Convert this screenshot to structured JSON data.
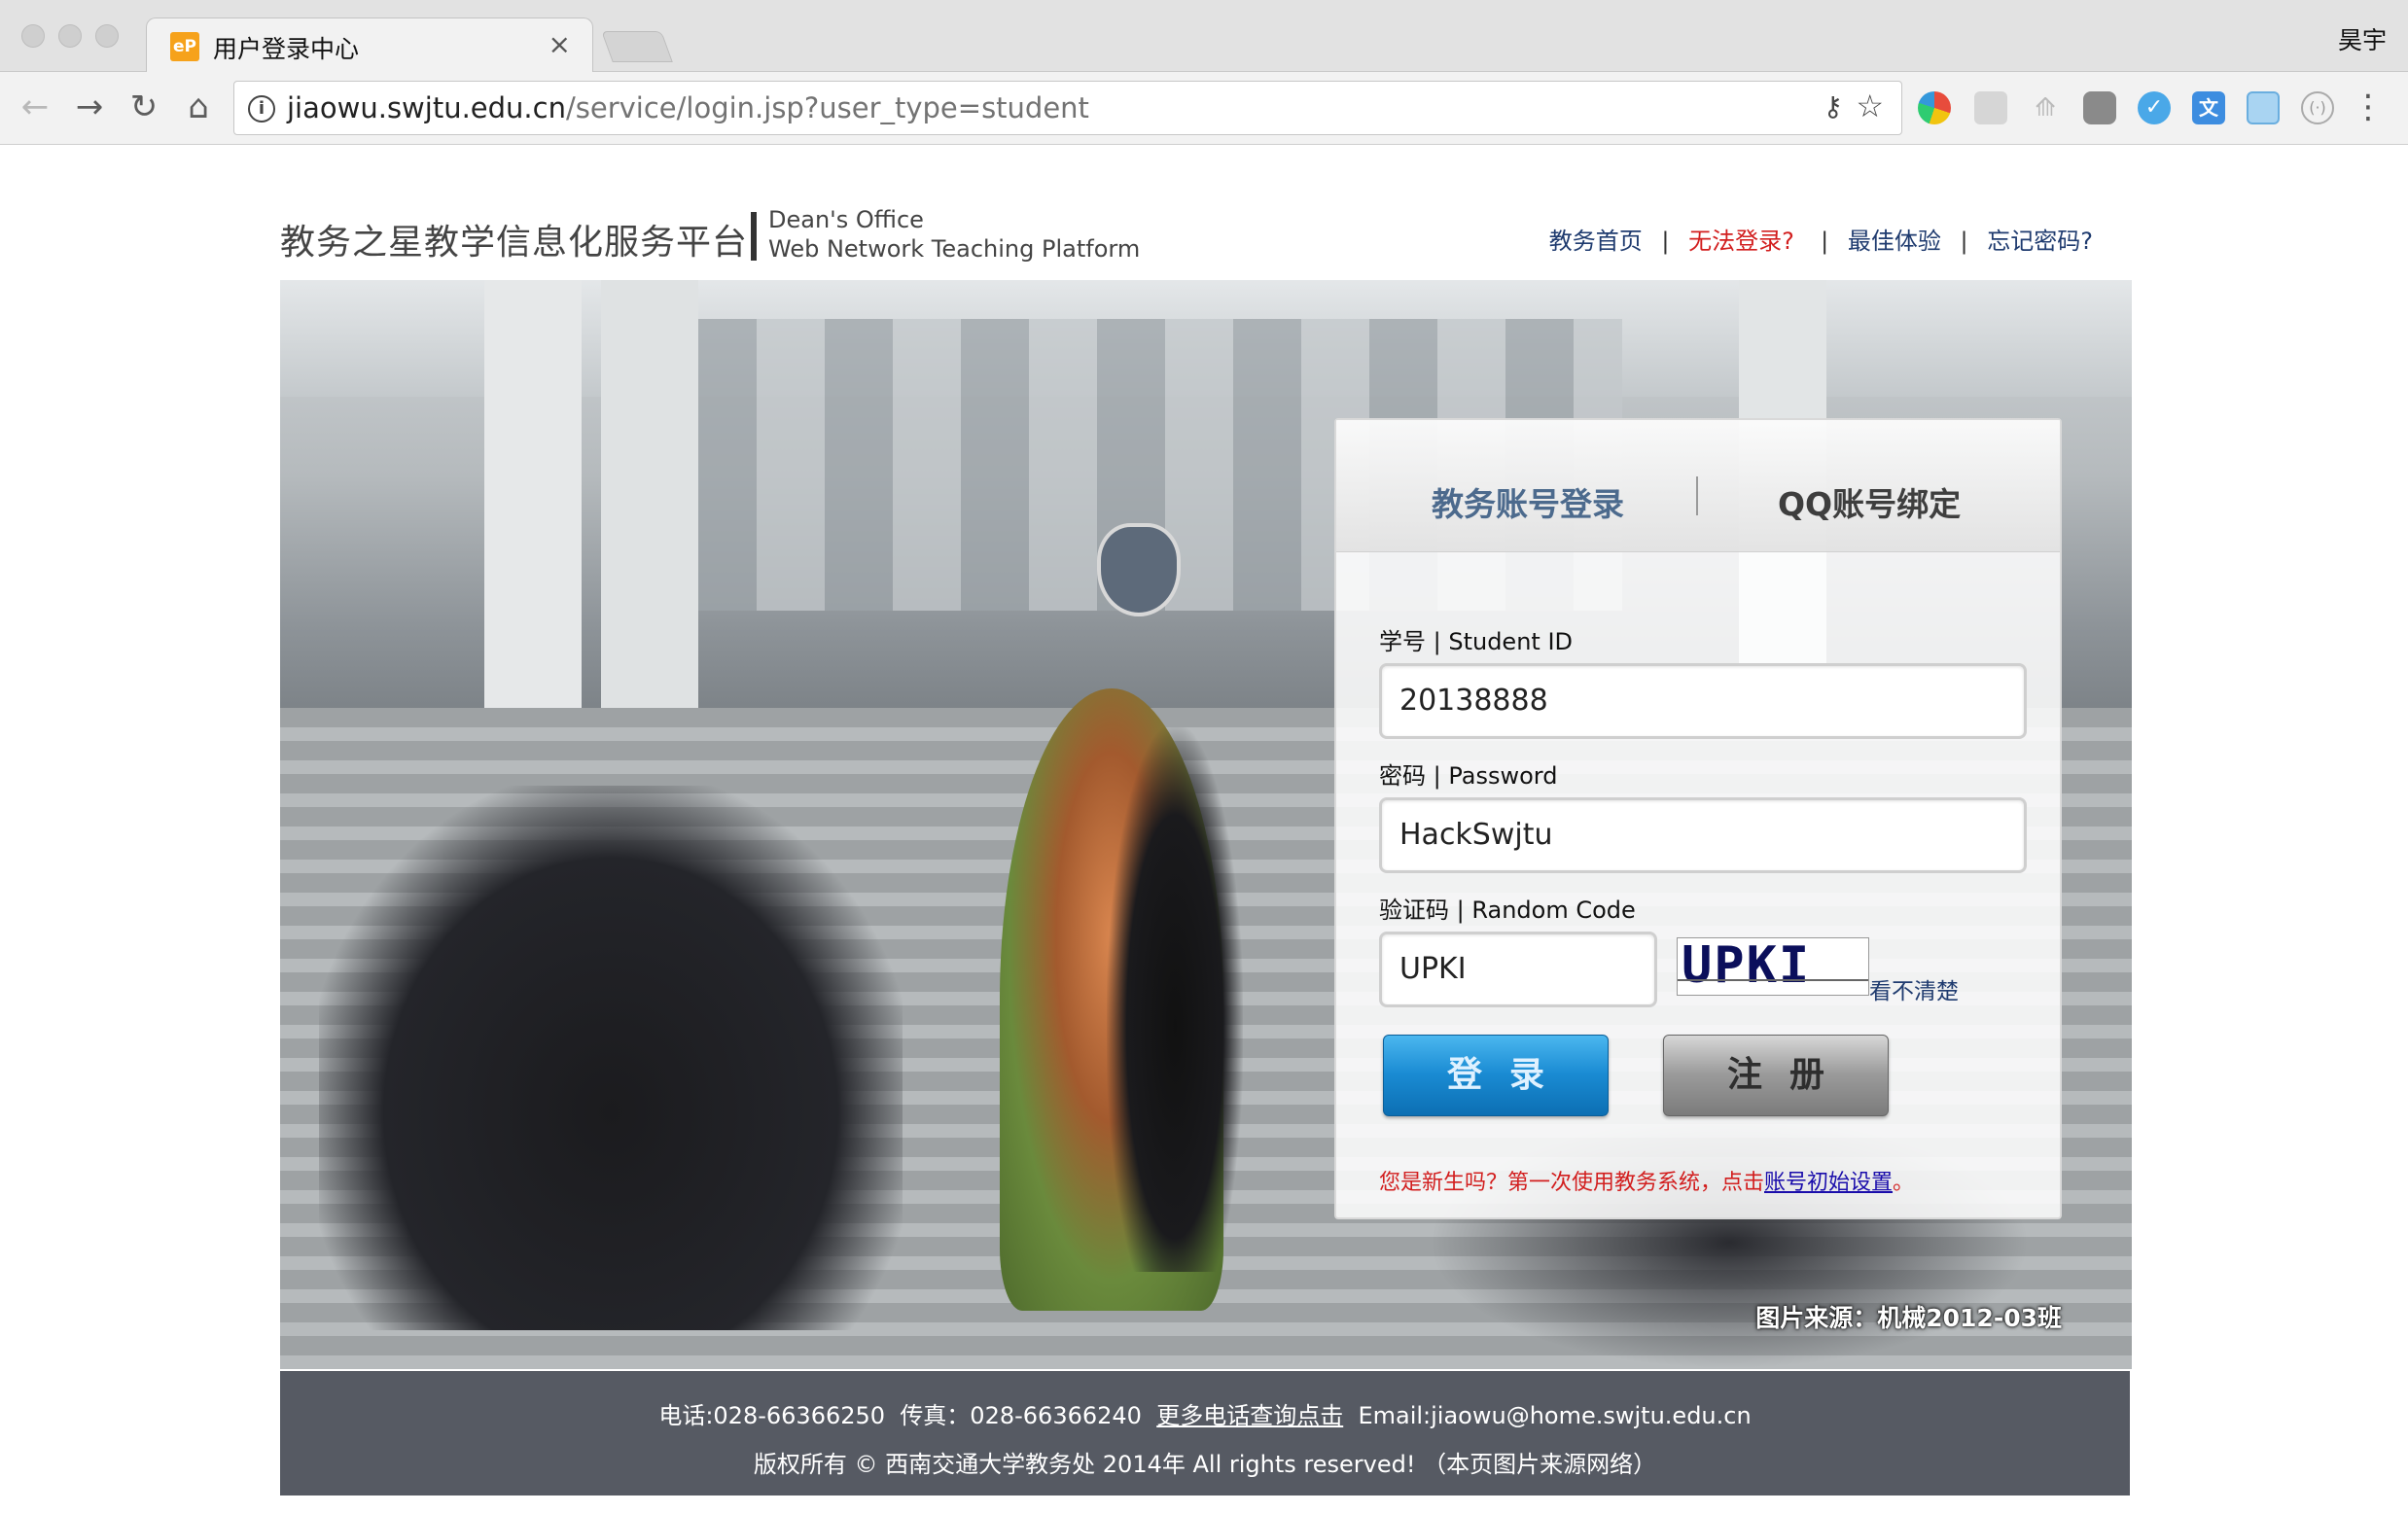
{
  "browser": {
    "tab_title": "用户登录中心",
    "favicon_text": "eP",
    "tab_close": "×",
    "profile_name": "昊宇",
    "url_host": "jiaowu.swjtu.edu.cn",
    "url_path": "/service/login.jsp?user_type=student",
    "nav": {
      "back": "←",
      "forward": "→",
      "reload": "↻",
      "home": "⌂"
    },
    "extensions": [
      "chrome-icon",
      "rss-icon",
      "tree-icon",
      "evernote-icon",
      "checkmark-icon",
      "translate-icon",
      "image-icon",
      "bracket-icon"
    ]
  },
  "header": {
    "logo_cn": "教务之星教学信息化服务平台",
    "logo_en_line1": "Dean's Office",
    "logo_en_line2": "Web Network Teaching Platform",
    "links": {
      "home": "教务首页",
      "cannot_login": "无法登录?",
      "best_experience": "最佳体验",
      "forgot_password": "忘记密码?"
    }
  },
  "hero": {
    "photo_credit": "图片来源：机械2012-03班"
  },
  "login": {
    "tabs": {
      "account": "教务账号登录",
      "qq": "QQ账号绑定"
    },
    "student_id_label": "学号 | Student ID",
    "student_id_value": "20138888",
    "password_label": "密码 | Password",
    "password_value": "HackSwjtu",
    "code_label": "验证码 | Random Code",
    "code_value": "UPKI",
    "captcha_text": "UPKI",
    "refresh_link": "看不清楚",
    "login_button": "登录",
    "register_button": "注册",
    "notice_prefix": "您是新生吗？第一次使用教务系统，点击",
    "notice_link": "账号初始设置",
    "notice_suffix": "。"
  },
  "footer": {
    "phone": "电话:028-66366250",
    "fax": "传真：028-66366240",
    "more_phones": "更多电话查询点击",
    "email": "Email:jiaowu@home.swjtu.edu.cn",
    "copyright": "版权所有 © 西南交通大学教务处 2014年 All rights reserved!  （本页图片来源网络）"
  },
  "colors": {
    "link_blue": "#1f3b6f",
    "alert_red": "#d21e1e",
    "login_button": "#1a8bd3",
    "footer_bg": "#565a63"
  }
}
